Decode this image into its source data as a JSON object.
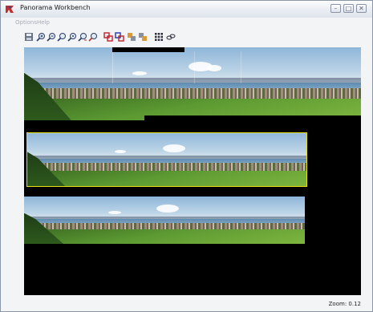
{
  "window": {
    "title": "Panorama Workbench",
    "buttons": [
      "minimize",
      "maximize",
      "close"
    ]
  },
  "menu": [
    "Options",
    "Help"
  ],
  "toolbar": {
    "icons": [
      "save-icon",
      "zoom-in-icon",
      "zoom-out-icon",
      "zoom-fit-icon",
      "zoom-reset-icon",
      "zoom-prev-icon",
      "zoom-next-icon",
      "layer-red-icon",
      "layer-blue-icon",
      "layer-merge-icon",
      "layer-split-icon",
      "grid-icon",
      "link-icon"
    ]
  },
  "panoramas": [
    {
      "name": "panorama-top"
    },
    {
      "name": "panorama-middle",
      "selected": true
    },
    {
      "name": "panorama-bottom"
    }
  ],
  "status": {
    "zoom": "Zoom: 0.12"
  },
  "colors": {
    "canvas": "#000000",
    "selection": "#e6e015"
  }
}
